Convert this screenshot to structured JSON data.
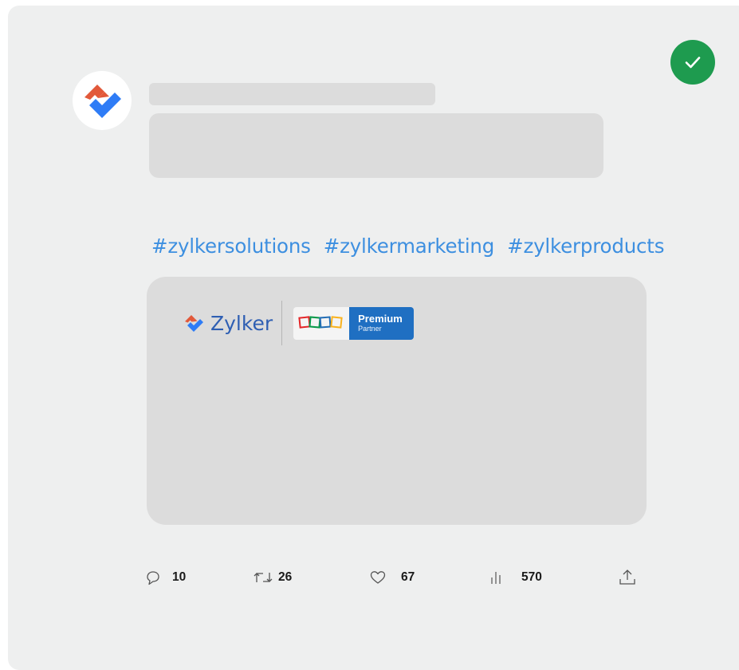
{
  "post": {
    "hashtags": [
      "#zylkersolutions",
      "#zylkermarketing",
      "#zylkerproducts"
    ],
    "media": {
      "brand_name": "Zylker",
      "partner_badge": {
        "title": "Premium",
        "subtitle": "Partner"
      }
    }
  },
  "actions": {
    "replies": "10",
    "reposts": "26",
    "likes": "67",
    "views": "570"
  },
  "icons": {
    "verified": "check-icon",
    "avatar": "zylker-logo-icon",
    "reply": "comment-icon",
    "repost": "repost-icon",
    "like": "heart-icon",
    "views": "bar-chart-icon",
    "share": "share-icon"
  },
  "colors": {
    "card_background": "#eeefef",
    "skeleton": "#dcdcdc",
    "hashtag": "#3d8fe0",
    "verified_badge": "#1e9b4f",
    "brand_text": "#2f5fb3",
    "logo_orange": "#e2593a",
    "logo_blue": "#2e7cf6",
    "badge_blue": "#1f6fc2"
  }
}
